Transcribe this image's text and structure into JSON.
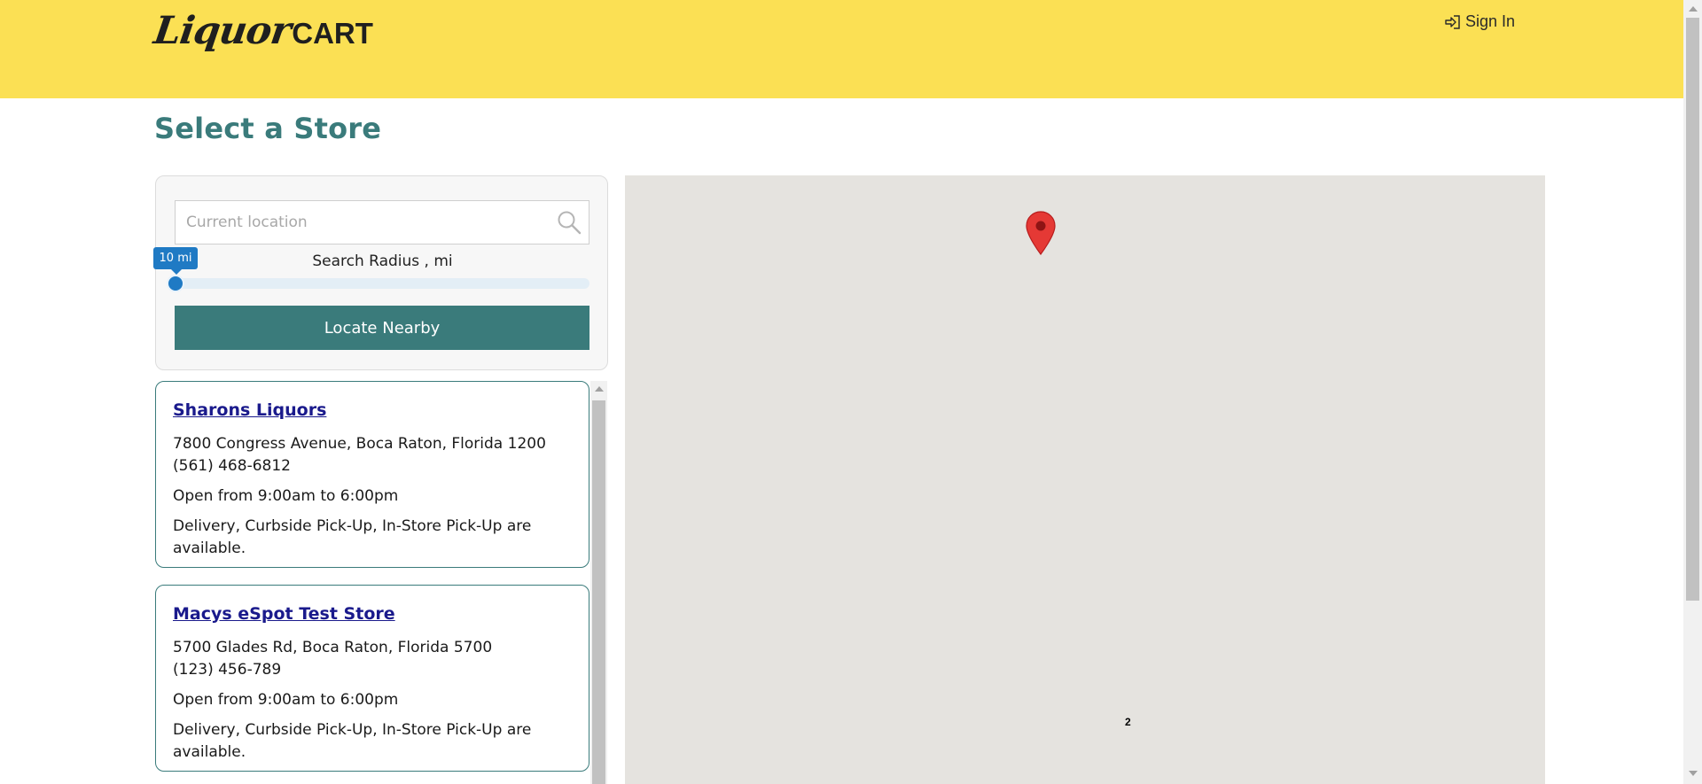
{
  "header": {
    "logo_script": "Liquor",
    "logo_cart": "CART",
    "signin_label": "Sign In",
    "signin_icon": "sign-in-icon"
  },
  "page": {
    "title": "Select a Store"
  },
  "search": {
    "placeholder": "Current location",
    "value": "",
    "search_icon": "magnifier-icon",
    "radius_bubble": "10 mi",
    "radius_label": "Search Radius , mi",
    "radius_value": 10,
    "radius_fraction": 0,
    "locate_label": "Locate Nearby"
  },
  "stores": [
    {
      "name": "Sharons Liquors",
      "address": "7800 Congress Avenue, Boca Raton, Florida 1200",
      "phone": "(561) 468-6812",
      "hours": "Open from 9:00am to 6:00pm",
      "availability": "Delivery, Curbside Pick-Up, In-Store Pick-Up are available."
    },
    {
      "name": "Macys eSpot Test Store",
      "address": "5700 Glades Rd, Boca Raton, Florida 5700",
      "phone": "(123) 456-789",
      "hours": "Open from 9:00am to 6:00pm",
      "availability": "Delivery, Curbside Pick-Up, In-Store Pick-Up are available."
    }
  ],
  "map": {
    "marker_icon": "map-pin-icon",
    "marker_color": "#e53935",
    "cluster_count": "2"
  },
  "colors": {
    "header_bg": "#fbe054",
    "accent": "#3a7b7b",
    "slider": "#1f7ac4",
    "link": "#1a1a8c",
    "map_bg": "#e5e3df"
  }
}
